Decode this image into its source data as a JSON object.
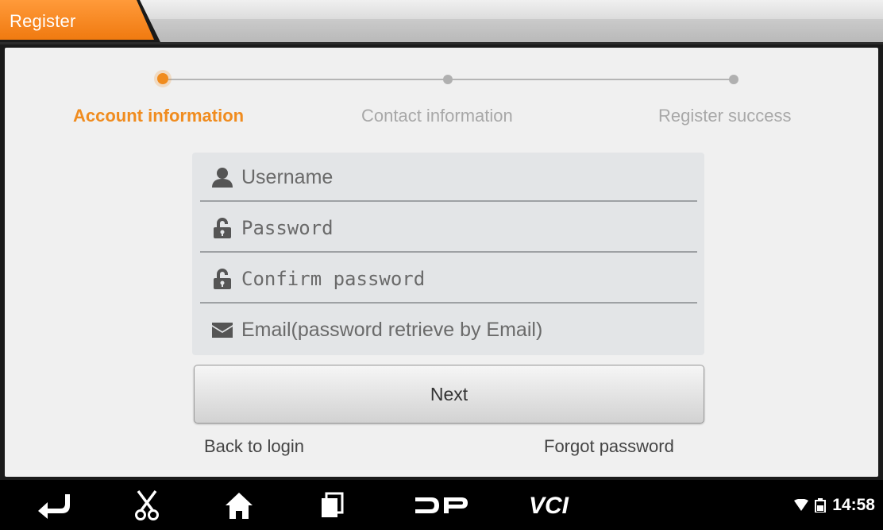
{
  "header": {
    "tab_title": "Register"
  },
  "stepper": {
    "steps": [
      {
        "label": "Account information",
        "state": "active"
      },
      {
        "label": "Contact information",
        "state": "inactive"
      },
      {
        "label": "Register success",
        "state": "inactive"
      }
    ],
    "active_color": "#f08c1f",
    "inactive_color": "#a8a8a8"
  },
  "form": {
    "username": {
      "placeholder": "Username",
      "value": "",
      "icon": "user-icon"
    },
    "password": {
      "placeholder": "Password",
      "value": "",
      "icon": "lock-icon"
    },
    "confirm_password": {
      "placeholder": "Confirm password",
      "value": "",
      "icon": "lock-icon"
    },
    "email": {
      "placeholder": "Email(password retrieve by Email)",
      "value": "",
      "icon": "mail-icon"
    }
  },
  "actions": {
    "next_label": "Next",
    "back_to_login": "Back to login",
    "forgot_password": "Forgot password"
  },
  "navbar": {
    "buttons": [
      "back-icon",
      "scissors-icon",
      "home-icon",
      "recent-apps-icon",
      "dp-icon",
      "vci-icon"
    ],
    "vci_text": "VCI"
  },
  "status_bar": {
    "time": "14:58",
    "icons": [
      "wifi-icon",
      "battery-icon"
    ]
  }
}
